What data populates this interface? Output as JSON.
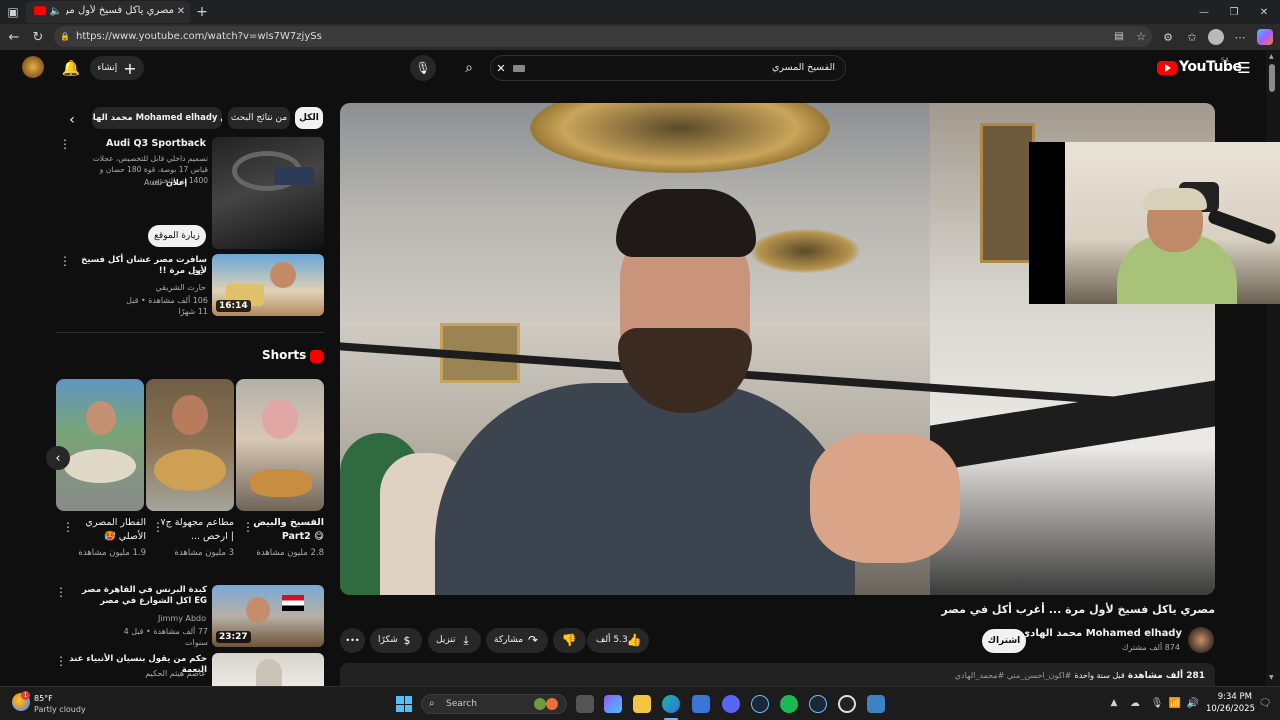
{
  "browser": {
    "tab_title": "مصري ياكل فسيخ لأول مرة ...",
    "url": "https://www.youtube.com/watch?v=wIs7W7zjySs",
    "new_tab": "+",
    "minimize": "—",
    "maximize": "❐",
    "close": "✕"
  },
  "youtube": {
    "logo_text": "YouTube",
    "logo_region": "SA",
    "search_value": "الفسيخ المسري",
    "create_label": "إنشاء"
  },
  "chips": [
    "الكل",
    "من نتائج البحث",
    "من Mohamed elhady محمد الهادي"
  ],
  "ad": {
    "title": "Audi Q3 Sportback",
    "description": "تصميم داخلي قابل للتخصيص، عجلات قياس 17 بوصة، قوة 180 حصان و 1400 لتر للتخزين.",
    "sponsored": "إعلان",
    "advertiser": "Audi",
    "cta": "زيارة الموقع"
  },
  "related_top": {
    "title": "سافرت مصر عشان أكل فسيخ لأول مرة !!",
    "flag": "EG",
    "channel": "حارث الشريقي",
    "views": "106 ألف مشاهدة",
    "age": "قبل 11 شهرًا",
    "duration": "16:14"
  },
  "shorts": {
    "heading": "Shorts",
    "items": [
      {
        "title": "الفسيخ والبيض 😋 Part2",
        "views": "2.8 مليون مشاهدة"
      },
      {
        "title": "مطاعم مجهولة ج٧ | ارخص ...",
        "views": "3 مليون مشاهدة"
      },
      {
        "title": "الفطار المصري الأصلي 🥵",
        "views": "1.9 مليون مشاهدة"
      }
    ]
  },
  "related_list": [
    {
      "title": "كبدة البرنس في القاهرة مصر EG اكل الشوارع في مصر",
      "channel": "Jimmy Abdo",
      "views": "77 ألف مشاهدة",
      "age": "قبل 4 سنوات",
      "duration": "23:27"
    },
    {
      "title": "حكم من يقول بنسيان الأنبياء عند النعمة",
      "channel": "عاصم هيثم الحكيم",
      "views": "",
      "age": "",
      "duration": ""
    }
  ],
  "video": {
    "title": "مصري ياكل فسيخ لأول مرة ... أغرب أكل في مصر",
    "channel_name": "Mohamed elhady محمد الهادي",
    "subscribers": "874 ألف مشترك",
    "subscribe": "اشتراك",
    "likes": "5.3 ألف",
    "share": "مشاركة",
    "download": "تنزيل",
    "thanks": "شكرًا",
    "more": "•••",
    "description_views": "281 ألف مشاهدة",
    "description_age": "قبل سنة واحدة",
    "hashtags": "#اكون_احسن_مني #محمد_الهادي"
  },
  "taskbar": {
    "weather_temp": "85°F",
    "weather_text": "Partly cloudy",
    "search_placeholder": "Search",
    "time": "9:34 PM",
    "date": "10/26/2025",
    "notif_badge": "1"
  },
  "colors": {
    "yt_red": "#ff0000",
    "bg": "#0f0f0f",
    "chip_active": "#f1f1f1"
  }
}
